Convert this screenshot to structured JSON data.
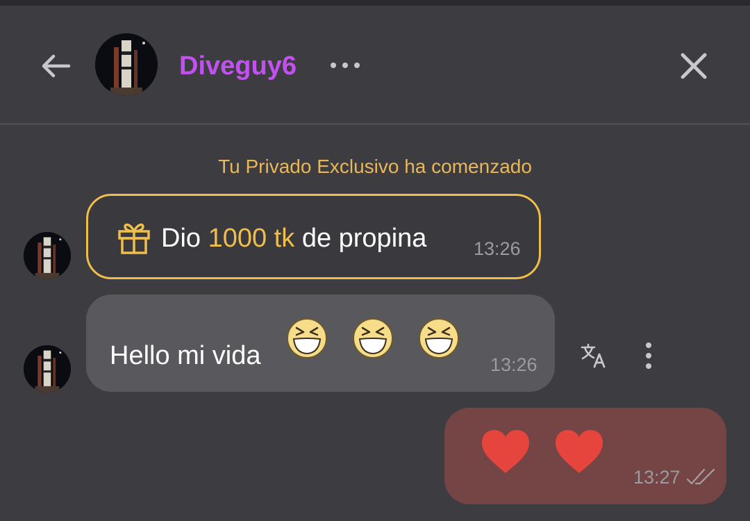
{
  "header": {
    "username": "Diveguy6",
    "icons": {
      "back": "arrow-left-icon",
      "more": "more-horizontal-icon",
      "close": "close-icon"
    }
  },
  "colors": {
    "background": "#3d3d41",
    "username": "#c251f0",
    "accent_gold": "#f0be4a",
    "system_text": "#e8b75a",
    "incoming_bubble": "#58585d",
    "outgoing_bubble": "#744544",
    "heart": "#e5453d"
  },
  "chat": {
    "system_message": "Tu Privado Exclusivo ha comenzado",
    "messages": [
      {
        "type": "tip",
        "prefix": "Dio",
        "amount": "1000 tk",
        "suffix": "de propina",
        "time": "13:26",
        "icon": "gift-icon"
      },
      {
        "type": "text",
        "text": "Hello mi vida",
        "emojis": [
          "laughing-face-emoji",
          "laughing-face-emoji",
          "laughing-face-emoji"
        ],
        "time": "13:26",
        "actions": [
          "translate-icon",
          "more-vertical-icon"
        ]
      },
      {
        "type": "outgoing",
        "emojis": [
          "red-heart-emoji",
          "red-heart-emoji"
        ],
        "time": "13:27",
        "status": "read-double-check-icon"
      }
    ]
  }
}
